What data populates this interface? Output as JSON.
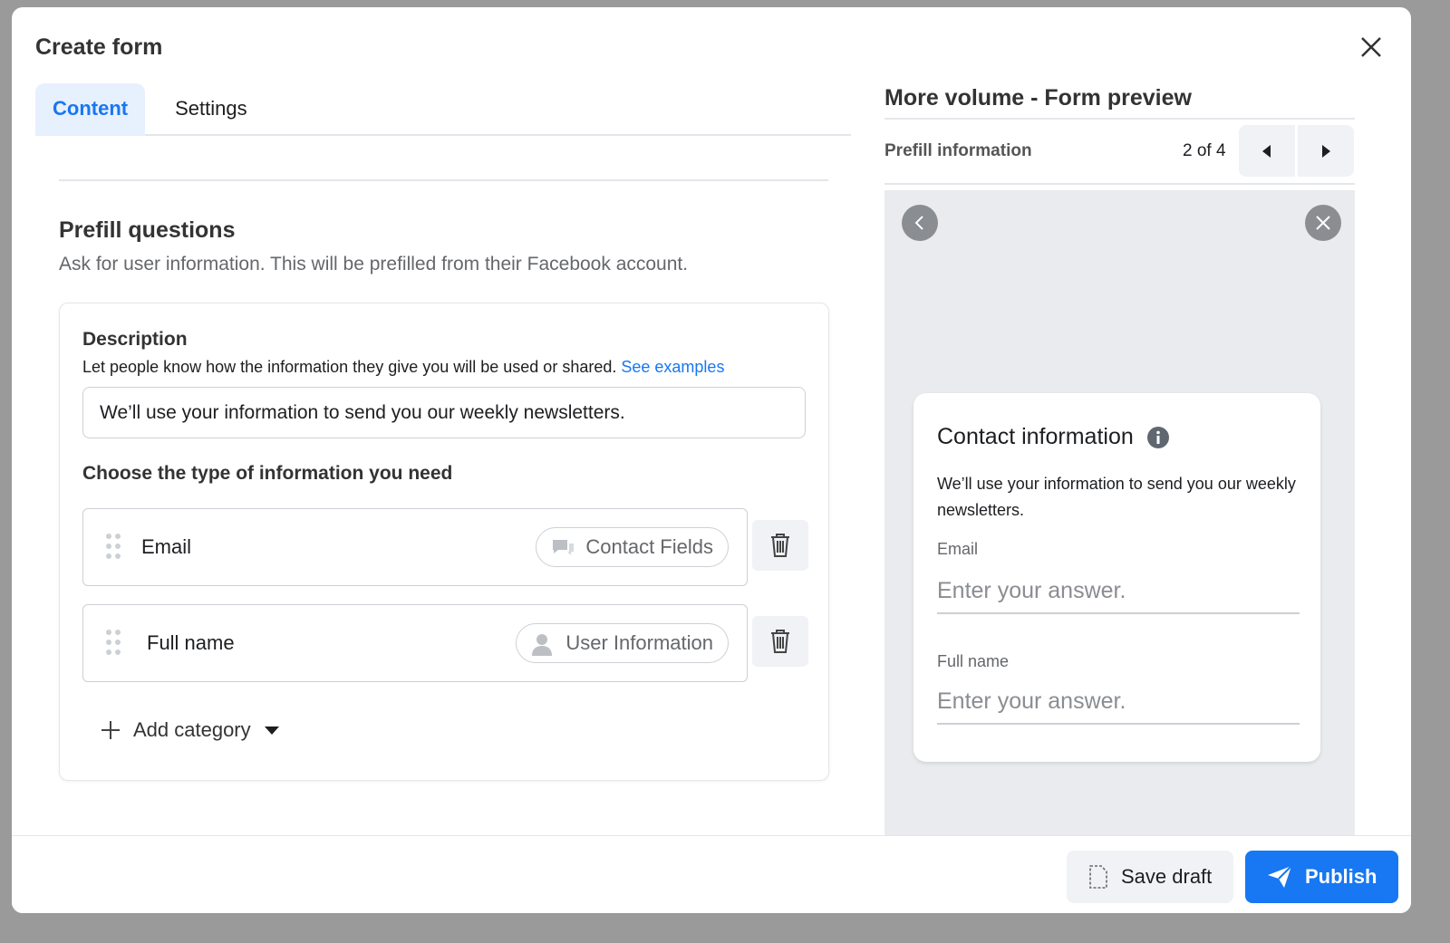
{
  "modal": {
    "title": "Create form"
  },
  "tabs": [
    {
      "label": "Content",
      "active": true
    },
    {
      "label": "Settings",
      "active": false
    }
  ],
  "prefill": {
    "heading": "Prefill questions",
    "subtitle": "Ask for user information. This will be prefilled from their Facebook account.",
    "description_label": "Description",
    "description_help": "Let people know how the information they give you will be used or shared.",
    "see_examples": "See examples",
    "description_value": "We’ll use your information to send you our weekly newsletters.",
    "choose_label": "Choose the type of information you need",
    "rows": [
      {
        "label": "Email",
        "category": "Contact Fields",
        "icon": "chat-bubbles-icon"
      },
      {
        "label": "Full name",
        "category": "User Information",
        "icon": "person-icon"
      }
    ],
    "add_category": "Add category"
  },
  "preview": {
    "title": "More volume - Form preview",
    "section": "Prefill information",
    "page": "2 of 4",
    "card_title": "Contact information",
    "card_text": "We’ll use your information to send you our weekly newsletters.",
    "fields": [
      {
        "label": "Email",
        "placeholder": "Enter your answer."
      },
      {
        "label": "Full name",
        "placeholder": "Enter your answer."
      }
    ]
  },
  "footer": {
    "save_draft": "Save draft",
    "publish": "Publish"
  },
  "colors": {
    "accent": "#1877f2",
    "tab_active_bg": "#e7f0fd"
  }
}
